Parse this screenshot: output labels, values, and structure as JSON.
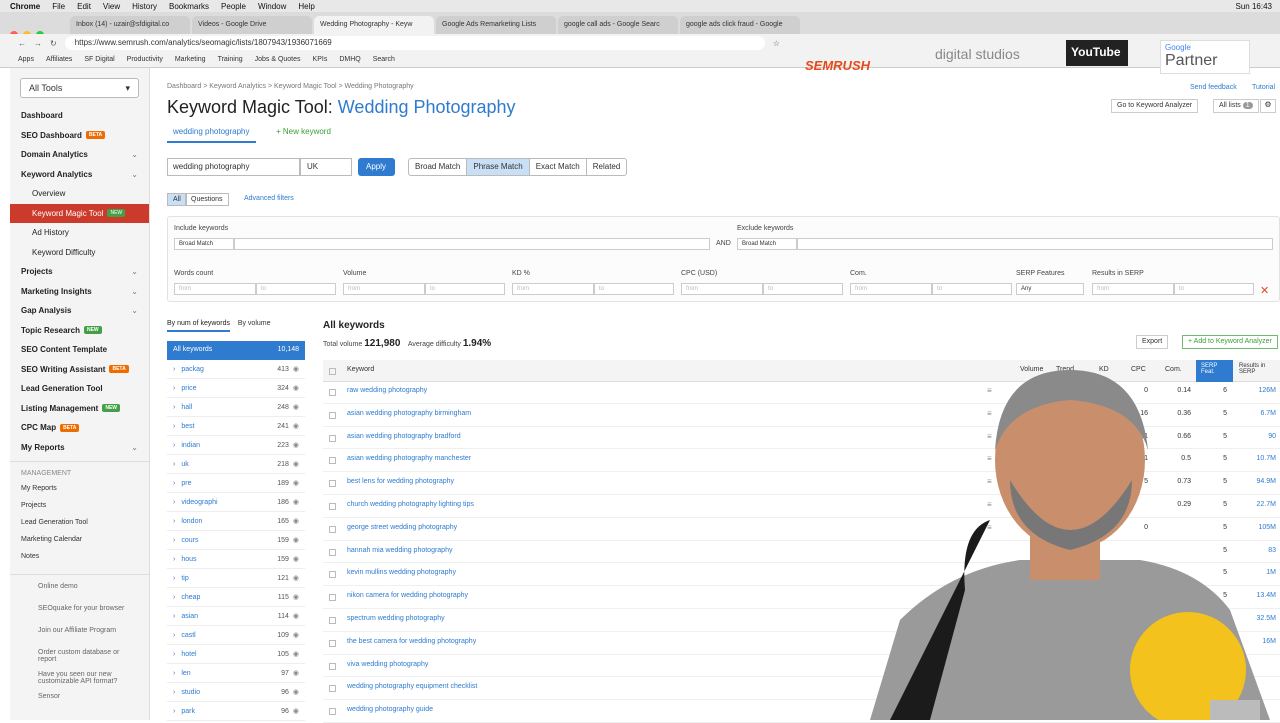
{
  "os": {
    "app": "Chrome",
    "menus": [
      "File",
      "Edit",
      "View",
      "History",
      "Bookmarks",
      "People",
      "Window",
      "Help"
    ],
    "clock": "Sun 16:43"
  },
  "tabs": [
    "Inbox (14) - uzair@sfdigital.co",
    "Videos - Google Drive",
    "Wedding Photography - Keyw",
    "Google Ads Remarketing Lists",
    "google call ads - Google Searc",
    "google ads click fraud - Google"
  ],
  "url": "https://www.semrush.com/analytics/seomagic/lists/1807943/1936071669",
  "bookmarks": [
    "Apps",
    "Affiliates",
    "SF Digital",
    "Productivity",
    "Marketing",
    "Training",
    "Jobs & Quotes",
    "KPIs",
    "DMHQ",
    "Search"
  ],
  "overlays": {
    "semrush": "SEMRUSH",
    "digital": "digital studios",
    "youtube": "YouTube",
    "google": "Google",
    "partner": "Partner"
  },
  "sidebar": {
    "all_tools": "All Tools",
    "items": [
      {
        "label": "Dashboard"
      },
      {
        "label": "SEO Dashboard",
        "badge": "BETA"
      },
      {
        "label": "Domain Analytics"
      },
      {
        "label": "Keyword Analytics"
      },
      {
        "label": "Overview",
        "sub": true
      },
      {
        "label": "Keyword Magic Tool",
        "sub": true,
        "badge": "NEW",
        "active": true
      },
      {
        "label": "Ad History",
        "sub": true
      },
      {
        "label": "Keyword Difficulty",
        "sub": true
      },
      {
        "label": "Projects"
      },
      {
        "label": "Marketing Insights"
      },
      {
        "label": "Gap Analysis"
      },
      {
        "label": "Topic Research",
        "badge": "NEW"
      },
      {
        "label": "SEO Content Template"
      },
      {
        "label": "SEO Writing Assistant",
        "badge": "BETA"
      },
      {
        "label": "Lead Generation Tool"
      },
      {
        "label": "Listing Management",
        "badge": "NEW"
      },
      {
        "label": "CPC Map",
        "badge": "BETA"
      },
      {
        "label": "My Reports"
      }
    ],
    "management_label": "MANAGEMENT",
    "management": [
      "My Reports",
      "Projects",
      "Lead Generation Tool",
      "Marketing Calendar",
      "Notes"
    ],
    "footer": [
      "Online demo",
      "SEOquake for your browser",
      "Join our Affiliate Program",
      "Order custom database or report",
      "Have you seen our new customizable API format?",
      "Sensor"
    ]
  },
  "header": {
    "breadcrumb": "Dashboard  >  Keyword Analytics  >  Keyword Magic Tool  >  Wedding Photography",
    "title": "Keyword Magic Tool:",
    "title_list": "Wedding Photography",
    "send_feedback": "Send feedback",
    "tutorial": "Tutorial",
    "go_analyzer": "Go to Keyword Analyzer",
    "all_lists": "All lists",
    "all_lists_count": "1"
  },
  "kw_tab": "wedding photography",
  "new_kw": "+ New keyword",
  "search": {
    "value": "wedding photography",
    "db": "UK",
    "apply": "Apply"
  },
  "match": [
    "Broad Match",
    "Phrase Match",
    "Exact Match",
    "Related"
  ],
  "qtabs": [
    "All",
    "Questions"
  ],
  "adv_filters": "Advanced filters",
  "filters": {
    "include": "Include keywords",
    "exclude": "Exclude keywords",
    "broad": "Broad Match",
    "and": "AND",
    "words": "Words count",
    "volume": "Volume",
    "kd": "KD %",
    "cpc": "CPC (USD)",
    "com": "Com.",
    "serpf": "SERP Features",
    "results": "Results in SERP",
    "from": "from",
    "to": "to",
    "any": "Any"
  },
  "groups_sort": [
    "By num of keywords",
    "By volume"
  ],
  "groups_all": {
    "label": "All keywords",
    "count": "10,148"
  },
  "groups": [
    [
      "packag",
      "413"
    ],
    [
      "price",
      "324"
    ],
    [
      "hall",
      "248"
    ],
    [
      "best",
      "241"
    ],
    [
      "indian",
      "223"
    ],
    [
      "uk",
      "218"
    ],
    [
      "pre",
      "189"
    ],
    [
      "videographi",
      "186"
    ],
    [
      "london",
      "165"
    ],
    [
      "cours",
      "159"
    ],
    [
      "hous",
      "159"
    ],
    [
      "tip",
      "121"
    ],
    [
      "cheap",
      "115"
    ],
    [
      "asian",
      "114"
    ],
    [
      "castl",
      "109"
    ],
    [
      "hotel",
      "105"
    ],
    [
      "len",
      "97"
    ],
    [
      "studio",
      "96"
    ],
    [
      "park",
      "96"
    ]
  ],
  "table": {
    "title": "All keywords",
    "total_label": "Total volume",
    "total": "121,980",
    "avg_label": "Average difficulty",
    "avg": "1.94%",
    "export": "Export",
    "add": "+ Add to Keyword Analyzer",
    "cols": [
      "Keyword",
      "Volume",
      "Trend",
      "KD",
      "CPC",
      "Com.",
      "SERP Feat.",
      "Results in SERP"
    ],
    "rows": [
      [
        "raw wedding photography",
        "",
        "0",
        "0.14",
        "6",
        "126M"
      ],
      [
        "asian wedding photography birmingham",
        "",
        "4.16",
        "0.36",
        "5",
        "6.7M"
      ],
      [
        "asian wedding photography bradford",
        "",
        "21",
        "0.66",
        "5",
        "90"
      ],
      [
        "asian wedding photography manchester",
        "",
        "31",
        "0.5",
        "5",
        "10.7M"
      ],
      [
        "best lens for wedding photography",
        "",
        "5",
        "0.73",
        "5",
        "94.9M"
      ],
      [
        "church wedding photography lighting tips",
        "",
        "",
        "0.29",
        "5",
        "22.7M"
      ],
      [
        "george street wedding photography",
        "",
        "0",
        "",
        "5",
        "105M"
      ],
      [
        "hannah mia wedding photography",
        "",
        "",
        "",
        "5",
        "83"
      ],
      [
        "kevin mullins wedding photography",
        "",
        "",
        "",
        "5",
        "1M"
      ],
      [
        "nikon camera for wedding photography",
        "",
        "",
        "",
        "5",
        "13.4M"
      ],
      [
        "spectrum wedding photography",
        "",
        "",
        "",
        "5",
        "32.5M"
      ],
      [
        "the best camera for wedding photography",
        "",
        "",
        "",
        "5",
        "16M"
      ],
      [
        "viva wedding photography",
        "",
        "",
        "",
        "",
        ""
      ],
      [
        "wedding photography equipment checklist",
        "",
        "",
        "",
        "",
        ""
      ],
      [
        "wedding photography guide",
        "",
        "",
        "",
        "",
        ""
      ]
    ]
  }
}
